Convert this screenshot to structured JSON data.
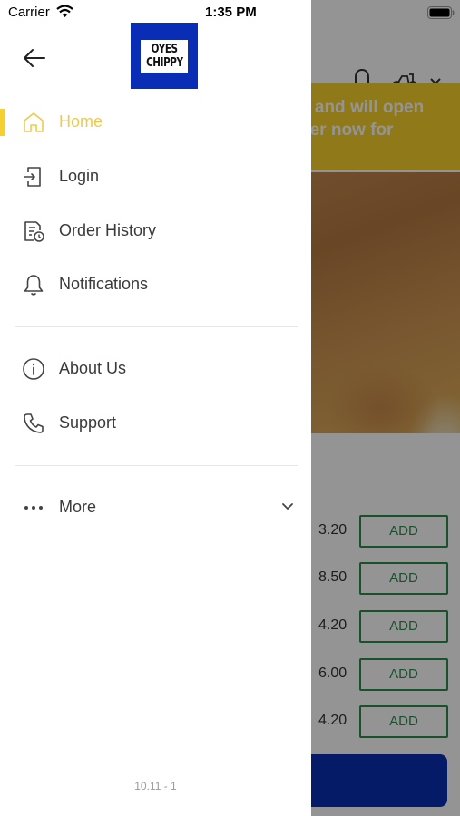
{
  "status_bar": {
    "carrier": "Carrier",
    "time": "1:35 PM"
  },
  "drawer": {
    "logo_lines": [
      "OYES",
      "CHIPPY"
    ],
    "menu": [
      {
        "key": "home",
        "label": "Home",
        "icon": "home-icon",
        "active": true
      },
      {
        "key": "login",
        "label": "Login",
        "icon": "login-icon"
      },
      {
        "key": "order-history",
        "label": "Order History",
        "icon": "order-history-icon"
      },
      {
        "key": "notifications",
        "label": "Notifications",
        "icon": "bell-icon"
      },
      {
        "key": "about-us",
        "label": "About Us",
        "icon": "info-icon"
      },
      {
        "key": "support",
        "label": "Support",
        "icon": "phone-icon"
      },
      {
        "key": "more",
        "label": "More",
        "icon": "more-icon"
      }
    ],
    "version": "10.11 - 1",
    "accent_color": "#f6cf33"
  },
  "background": {
    "banner_lines": [
      "d and will open",
      "der now for"
    ],
    "items": [
      {
        "price": "3.20",
        "add_label": "ADD"
      },
      {
        "price": "8.50",
        "add_label": "ADD"
      },
      {
        "price": "4.20",
        "add_label": "ADD"
      },
      {
        "price": "6.00",
        "add_label": "ADD"
      },
      {
        "price": "4.20",
        "add_label": "ADD"
      }
    ],
    "brand_color": "#0a2fb3",
    "banner_color": "#f6d02c",
    "add_color": "#2e8a4a"
  }
}
